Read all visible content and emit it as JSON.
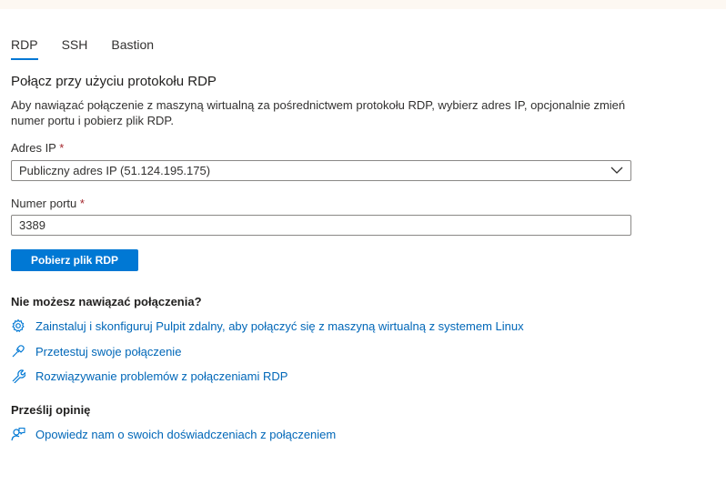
{
  "tabs": [
    {
      "label": "RDP"
    },
    {
      "label": "SSH"
    },
    {
      "label": "Bastion"
    }
  ],
  "heading": "Połącz przy użyciu protokołu RDP",
  "description": "Aby nawiązać połączenie z maszyną wirtualną za pośrednictwem protokołu RDP, wybierz adres IP, opcjonalnie zmień numer portu i pobierz plik RDP.",
  "ip_field": {
    "label": "Adres IP",
    "required_marker": "*",
    "value": "Publiczny adres IP (51.124.195.175)"
  },
  "port_field": {
    "label": "Numer portu",
    "required_marker": "*",
    "value": "3389"
  },
  "download_button": "Pobierz plik RDP",
  "troubleshoot": {
    "title": "Nie możesz nawiązać połączenia?",
    "links": [
      {
        "icon": "gear-icon",
        "label": "Zainstaluj i skonfiguruj Pulpit zdalny, aby połączyć się z maszyną wirtualną z systemem Linux"
      },
      {
        "icon": "plug-icon",
        "label": "Przetestuj swoje połączenie"
      },
      {
        "icon": "wrench-icon",
        "label": "Rozwiązywanie problemów z połączeniami RDP"
      }
    ]
  },
  "feedback": {
    "title": "Prześlij opinię",
    "link": {
      "icon": "feedback-person-icon",
      "label": "Opowiedz nam o swoich doświadczeniach z połączeniem"
    }
  },
  "colors": {
    "accent": "#0078d4",
    "link": "#0067b8",
    "required": "#a4262c"
  }
}
